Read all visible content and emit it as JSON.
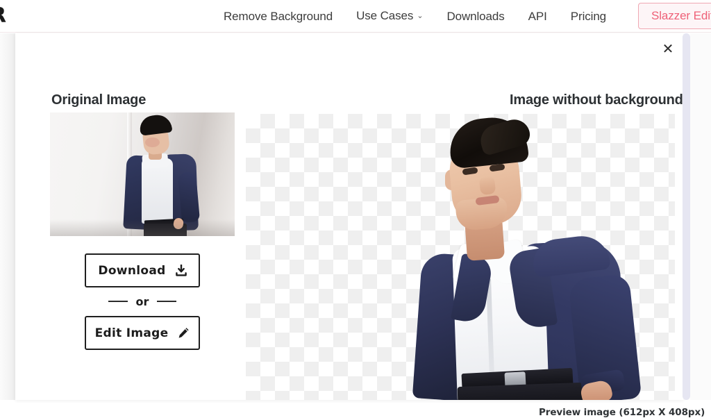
{
  "navbar": {
    "logo_text": "ER",
    "links": [
      {
        "label": "Remove Background",
        "has_chevron": false
      },
      {
        "label": "Use Cases",
        "has_chevron": true
      },
      {
        "label": "Downloads",
        "has_chevron": false
      },
      {
        "label": "API",
        "has_chevron": false
      },
      {
        "label": "Pricing",
        "has_chevron": false
      }
    ],
    "chevron_glyph": "⌄",
    "cta_label": "Slazzer Edit",
    "cta_color": "#ef6178",
    "cta_border_color": "#f0a7b2"
  },
  "card": {
    "close_glyph": "✕",
    "original": {
      "heading": "Original Image",
      "image_alt": "Man in navy blue suit leaning against a light gray wall"
    },
    "result": {
      "heading": "Image without background",
      "image_alt": "Man in navy blue suit cut out on transparent checkerboard background",
      "caption": "Preview image (612px X 408px)"
    },
    "actions": {
      "download_label": "Download",
      "download_icon": "download-icon",
      "or_label": "or",
      "edit_label": "Edit Image",
      "edit_icon": "pencil-icon"
    }
  },
  "colors": {
    "accent_pink": "#ef6178",
    "text_dark": "#2d3134",
    "button_border": "#1f1f1f",
    "checker_light": "#ffffff",
    "checker_gray": "#efefef",
    "suit_navy": "#2e3251",
    "scrollbar": "#e6e6f2"
  }
}
